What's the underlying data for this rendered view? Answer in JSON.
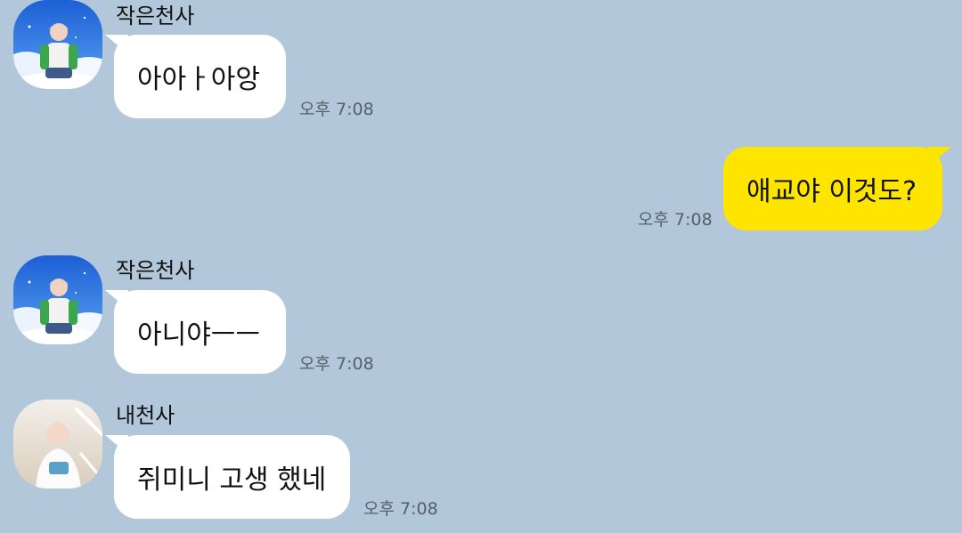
{
  "messages": [
    {
      "sender": "작은천사",
      "text": "아아ㅏ아앙",
      "time": "오후 7:08",
      "direction": "incoming"
    },
    {
      "sender": "",
      "text": "애교야 이것도?",
      "time": "오후 7:08",
      "direction": "outgoing"
    },
    {
      "sender": "작은천사",
      "text": "아니야ㅡㅡ",
      "time": "오후 7:08",
      "direction": "incoming"
    },
    {
      "sender": "내천사",
      "text": "쥐미니 고생 했네",
      "time": "오후 7:08",
      "direction": "incoming"
    }
  ],
  "colors": {
    "background": "#b2c7d9",
    "incoming_bubble": "#ffffff",
    "outgoing_bubble": "#fee500",
    "time_text": "#55606b"
  },
  "icons": [
    "profile-avatar-angel-sky",
    "profile-avatar-angel-white"
  ]
}
